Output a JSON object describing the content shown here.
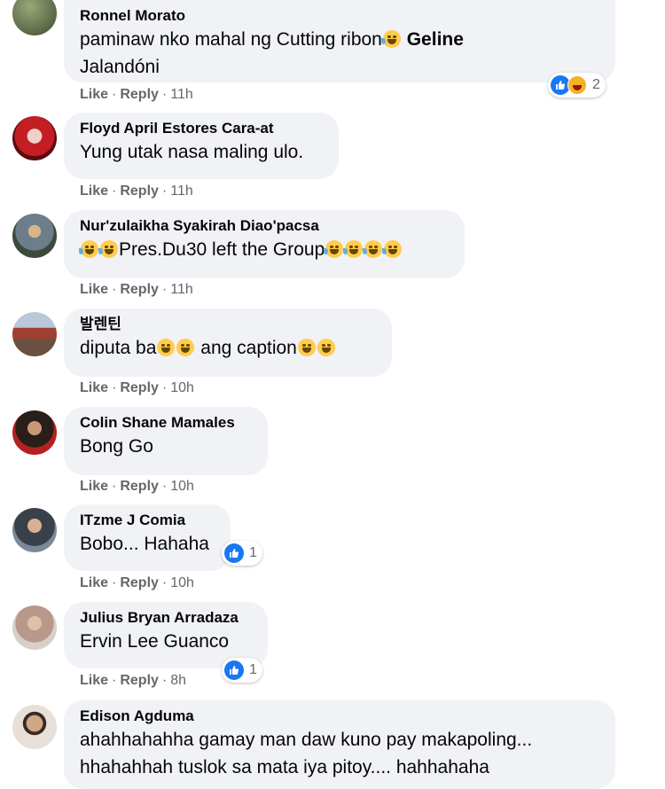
{
  "comments": [
    {
      "author": "Ronnel Morato",
      "text_line1": "paminaw nko mahal ng Cutting ribon",
      "tag_line1": "Geline",
      "text_line2": "Jalandóni",
      "actions": {
        "like": "Like",
        "reply": "Reply",
        "time": "11h"
      },
      "reaction_count": "2",
      "avatar_color": "#5b6b4a"
    },
    {
      "author": "Floyd April Estores Cara-at",
      "text": "Yung utak nasa maling ulo.",
      "actions": {
        "like": "Like",
        "reply": "Reply",
        "time": "11h"
      },
      "avatar_color": "#b8181e"
    },
    {
      "author": "Nur'zulaikha Syakirah Diao'pacsa",
      "text": "Pres.Du30 left the Group",
      "actions": {
        "like": "Like",
        "reply": "Reply",
        "time": "11h"
      },
      "avatar_color": "#7a8a9a"
    },
    {
      "author": "발렌틴",
      "text_a": "diputa ba",
      "text_b": "ang caption",
      "actions": {
        "like": "Like",
        "reply": "Reply",
        "time": "10h"
      },
      "avatar_color": "#8a7a70"
    },
    {
      "author": "Colin Shane Mamales",
      "text": "Bong Go",
      "actions": {
        "like": "Like",
        "reply": "Reply",
        "time": "10h"
      },
      "avatar_color": "#3a2a22"
    },
    {
      "author": "ITzme J Comia",
      "text": "Bobo... Hahaha",
      "reaction_count": "1",
      "actions": {
        "like": "Like",
        "reply": "Reply",
        "time": "10h"
      },
      "avatar_color": "#4a5a68"
    },
    {
      "author": "Julius Bryan Arradaza",
      "text": "Ervin Lee Guanco",
      "reaction_count": "1",
      "actions": {
        "like": "Like",
        "reply": "Reply",
        "time": "8h"
      },
      "avatar_color": "#b09a8a"
    },
    {
      "author": "Edison Agduma",
      "text_line1": "ahahhahahha gamay man daw kuno pay makapoling...",
      "text_line2": "hhahahhah tuslok sa mata iya pitoy.... hahhahaha",
      "avatar_color": "#c8a890"
    }
  ],
  "colors": {
    "bubble": "#f0f2f5",
    "secondary_text": "#65676b",
    "like_blue": "#1877f2"
  }
}
